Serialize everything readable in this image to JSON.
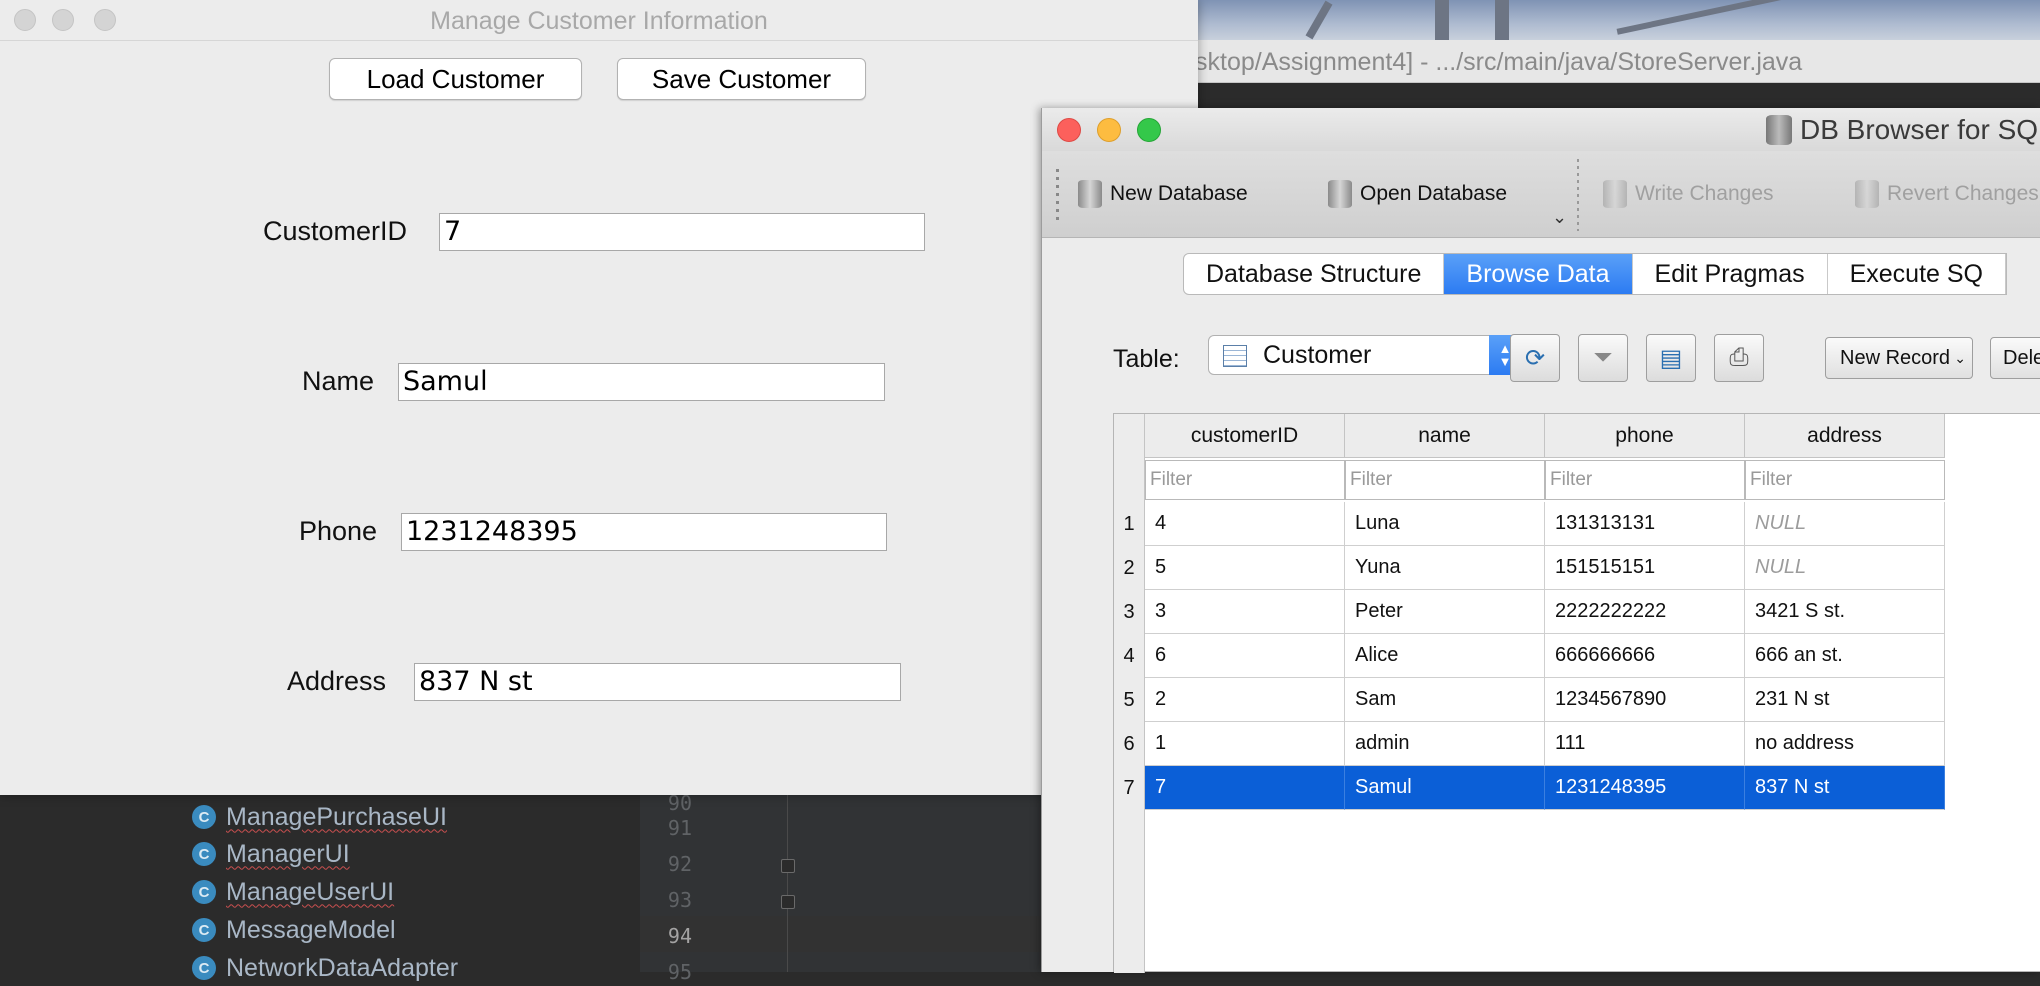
{
  "background": {
    "ide_title": "sktop/Assignment4] - .../src/main/java/StoreServer.java",
    "tree_items": [
      "ManagePurchaseUI",
      "ManagerUI",
      "ManageUserUI",
      "MessageModel",
      "NetworkDataAdapter"
    ],
    "class_icon_letter": "C",
    "line_numbers": [
      "90",
      "91",
      "92",
      "93",
      "94",
      "95"
    ]
  },
  "swing": {
    "title": "Manage Customer Information",
    "load_button": "Load Customer",
    "save_button": "Save Customer",
    "fields": {
      "customer_id_label": "CustomerID",
      "customer_id_value": "7",
      "name_label": "Name",
      "name_value": "Samul",
      "phone_label": "Phone",
      "phone_value": "1231248395",
      "address_label": "Address",
      "address_value": "837 N st"
    }
  },
  "dbbrowser": {
    "title": "DB Browser for SQL",
    "toolbar": {
      "new_database": "New Database",
      "open_database": "Open Database",
      "write_changes": "Write Changes",
      "revert_changes": "Revert Changes"
    },
    "tabs": [
      "Database Structure",
      "Browse Data",
      "Edit Pragmas",
      "Execute SQ"
    ],
    "active_tab": "Browse Data",
    "table_label": "Table:",
    "table_selected": "Customer",
    "new_record": "New Record",
    "delete_record": "Dele",
    "columns": [
      "customerID",
      "name",
      "phone",
      "address"
    ],
    "filter_placeholder": "Filter",
    "rows": [
      {
        "num": "1",
        "customerID": "4",
        "name": "Luna",
        "phone": "131313131",
        "address": "NULL"
      },
      {
        "num": "2",
        "customerID": "5",
        "name": "Yuna",
        "phone": "151515151",
        "address": "NULL"
      },
      {
        "num": "3",
        "customerID": "3",
        "name": "Peter",
        "phone": "2222222222",
        "address": "3421 S st."
      },
      {
        "num": "4",
        "customerID": "6",
        "name": "Alice",
        "phone": "666666666",
        "address": "666 an st."
      },
      {
        "num": "5",
        "customerID": "2",
        "name": "Sam",
        "phone": "1234567890",
        "address": "231 N st"
      },
      {
        "num": "6",
        "customerID": "1",
        "name": "admin",
        "phone": "111",
        "address": "no address"
      },
      {
        "num": "7",
        "customerID": "7",
        "name": "Samul",
        "phone": "1231248395",
        "address": "837 N st"
      }
    ],
    "selected_row": 7,
    "colors": {
      "selection": "#0b5fd7",
      "tab_active": "#2c7bf2",
      "close": "#fc605c",
      "minimize": "#fdbc40",
      "zoom": "#34c84a"
    }
  }
}
